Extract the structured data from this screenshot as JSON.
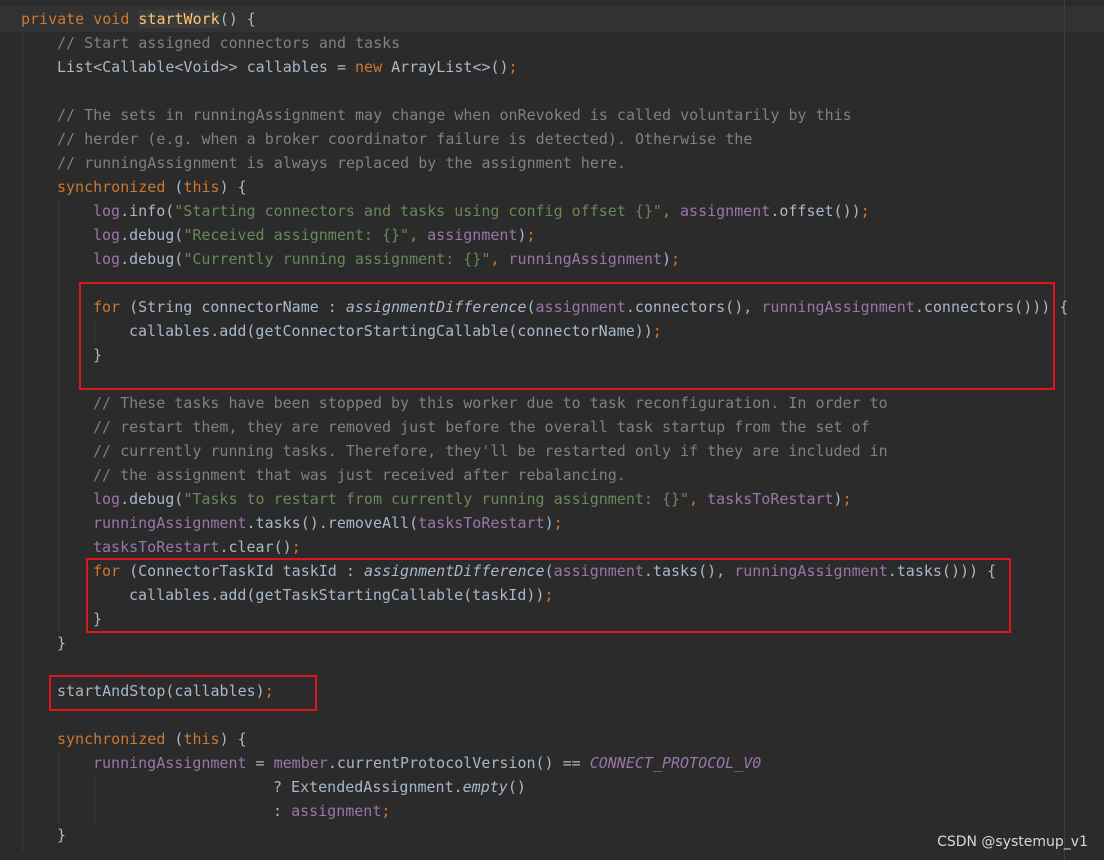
{
  "watermark": "CSDN @systemup_v1",
  "code": {
    "l1": {
      "kw": "private void ",
      "fn": "startWork",
      "rest": "() {"
    },
    "l2": {
      "comment": "// Start assigned connectors and tasks"
    },
    "l3": {
      "a": "List<Callable<Void>> callables = ",
      "kw": "new",
      "b": " ArrayList<>()",
      "semi": ";"
    },
    "l5": {
      "comment": "// The sets in runningAssignment may change when onRevoked is called voluntarily by this"
    },
    "l6": {
      "comment": "// herder (e.g. when a broker coordinator failure is detected). Otherwise the"
    },
    "l7": {
      "comment": "// runningAssignment is always replaced by the assignment here."
    },
    "l8": {
      "kw": "synchronized",
      "a": " (",
      "kw2": "this",
      "b": ") {"
    },
    "l9": {
      "f1": "log",
      "m": ".info(",
      "s": "\"Starting connectors and tasks using config offset {}\"",
      "c": ", ",
      "f2": "assignment",
      "e": ".offset())",
      "semi": ";"
    },
    "l10": {
      "f1": "log",
      "m": ".debug(",
      "s": "\"Received assignment: {}\"",
      "c": ", ",
      "f2": "assignment",
      "e": ")",
      "semi": ";"
    },
    "l11": {
      "f1": "log",
      "m": ".debug(",
      "s": "\"Currently running assignment: {}\"",
      "c": ", ",
      "f2": "runningAssignment",
      "e": ")",
      "semi": ";"
    },
    "l13": {
      "kw": "for",
      "a": " (String connectorName : ",
      "i": "assignmentDifference",
      "b": "(",
      "f1": "assignment",
      "c": ".connectors(), ",
      "f2": "runningAssignment",
      "d": ".connectors())) {"
    },
    "l14": {
      "a": "callables.add(getConnectorStartingCallable(connectorName))",
      "semi": ";"
    },
    "l15": {
      "a": "}"
    },
    "l17": {
      "comment": "// These tasks have been stopped by this worker due to task reconfiguration. In order to"
    },
    "l18": {
      "comment": "// restart them, they are removed just before the overall task startup from the set of"
    },
    "l19": {
      "comment": "// currently running tasks. Therefore, they'll be restarted only if they are included in"
    },
    "l20": {
      "comment": "// the assignment that was just received after rebalancing."
    },
    "l21": {
      "f1": "log",
      "m": ".debug(",
      "s": "\"Tasks to restart from currently running assignment: {}\"",
      "c": ", ",
      "f2": "tasksToRestart",
      "e": ")",
      "semi": ";"
    },
    "l22": {
      "f1": "runningAssignment",
      "m": ".tasks().removeAll(",
      "f2": "tasksToRestart",
      "e": ")",
      "semi": ";"
    },
    "l23": {
      "f1": "tasksToRestart",
      "m": ".clear()",
      "semi": ";"
    },
    "l24": {
      "kw": "for",
      "a": " (ConnectorTaskId taskId : ",
      "i": "assignmentDifference",
      "b": "(",
      "f1": "assignment",
      "c": ".tasks(), ",
      "f2": "runningAssignment",
      "d": ".tasks())) {"
    },
    "l25": {
      "a": "callables.add(getTaskStartingCallable(taskId))",
      "semi": ";"
    },
    "l26": {
      "a": "}"
    },
    "l27": {
      "a": "}"
    },
    "l29": {
      "a": "startAndStop(callables)",
      "semi": ";"
    },
    "l31": {
      "kw": "synchronized",
      "a": " (",
      "kw2": "this",
      "b": ") {"
    },
    "l32": {
      "f1": "runningAssignment",
      "a": " = ",
      "f2": "member",
      "b": ".currentProtocolVersion() == ",
      "c": "CONNECT_PROTOCOL_V0"
    },
    "l33": {
      "a": "? ExtendedAssignment.",
      "i": "empty",
      "b": "()"
    },
    "l34": {
      "a": ": ",
      "f": "assignment",
      "semi": ";"
    },
    "l35": {
      "a": "}"
    }
  }
}
